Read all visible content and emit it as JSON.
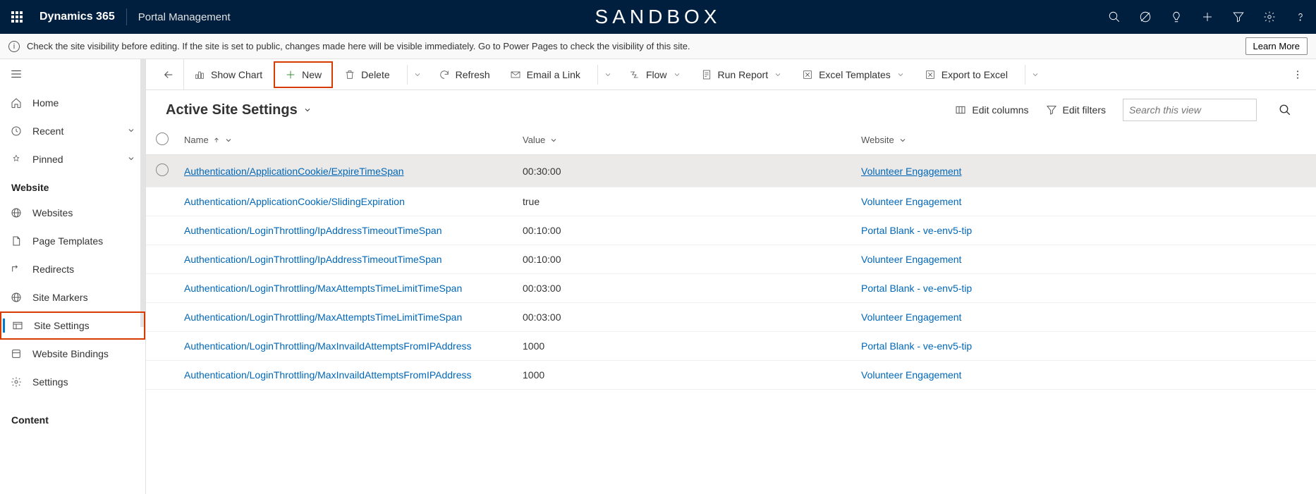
{
  "header": {
    "brand": "Dynamics 365",
    "app": "Portal Management",
    "env": "SANDBOX"
  },
  "banner": {
    "text": "Check the site visibility before editing. If the site is set to public, changes made here will be visible immediately. Go to Power Pages to check the visibility of this site.",
    "learnMore": "Learn More"
  },
  "sidebar": {
    "home": "Home",
    "recent": "Recent",
    "pinned": "Pinned",
    "group1": "Website",
    "items1": [
      "Websites",
      "Page Templates",
      "Redirects",
      "Site Markers",
      "Site Settings",
      "Website Bindings",
      "Settings"
    ],
    "group2": "Content"
  },
  "commands": {
    "showChart": "Show Chart",
    "new": "New",
    "delete": "Delete",
    "refresh": "Refresh",
    "emailLink": "Email a Link",
    "flow": "Flow",
    "runReport": "Run Report",
    "excelTemplates": "Excel Templates",
    "exportExcel": "Export to Excel"
  },
  "view": {
    "title": "Active Site Settings",
    "editColumns": "Edit columns",
    "editFilters": "Edit filters",
    "searchPlaceholder": "Search this view"
  },
  "columns": {
    "c1": "Name",
    "c2": "Value",
    "c3": "Website"
  },
  "rows": [
    {
      "name": "Authentication/ApplicationCookie/ExpireTimeSpan",
      "value": "00:30:00",
      "site": "Volunteer Engagement",
      "hov": true
    },
    {
      "name": "Authentication/ApplicationCookie/SlidingExpiration",
      "value": "true",
      "site": "Volunteer Engagement"
    },
    {
      "name": "Authentication/LoginThrottling/IpAddressTimeoutTimeSpan",
      "value": "00:10:00",
      "site": "Portal Blank - ve-env5-tip"
    },
    {
      "name": "Authentication/LoginThrottling/IpAddressTimeoutTimeSpan",
      "value": "00:10:00",
      "site": "Volunteer Engagement"
    },
    {
      "name": "Authentication/LoginThrottling/MaxAttemptsTimeLimitTimeSpan",
      "value": "00:03:00",
      "site": "Portal Blank - ve-env5-tip"
    },
    {
      "name": "Authentication/LoginThrottling/MaxAttemptsTimeLimitTimeSpan",
      "value": "00:03:00",
      "site": "Volunteer Engagement"
    },
    {
      "name": "Authentication/LoginThrottling/MaxInvaildAttemptsFromIPAddress",
      "value": "1000",
      "site": "Portal Blank - ve-env5-tip"
    },
    {
      "name": "Authentication/LoginThrottling/MaxInvaildAttemptsFromIPAddress",
      "value": "1000",
      "site": "Volunteer Engagement"
    }
  ]
}
